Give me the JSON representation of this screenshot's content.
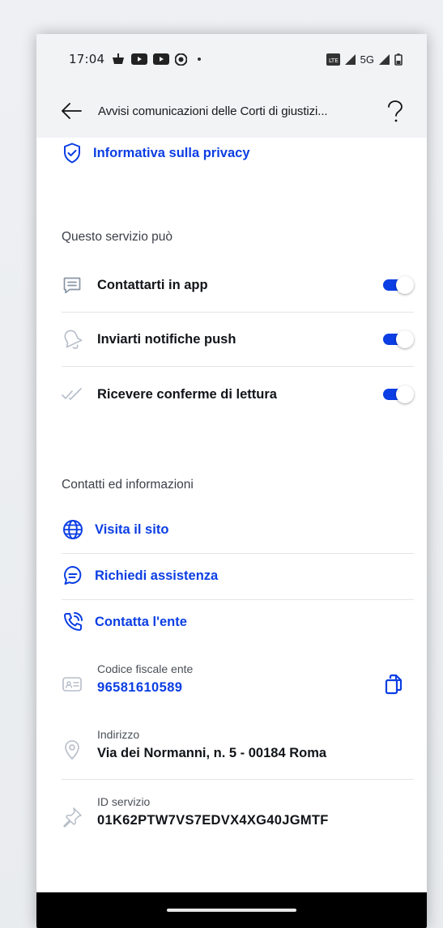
{
  "status_bar": {
    "time": "17:04",
    "network_label": "5G",
    "icons": [
      "app-notification-icon",
      "youtube-icon",
      "youtube-icon",
      "chrome-icon",
      "dot-icon",
      "volte-icon",
      "signal-icon",
      "signal-icon",
      "battery-icon"
    ]
  },
  "app_bar": {
    "title": "Avvisi comunicazioni delle Corti di giustizi...",
    "back_icon": "arrow-left-icon",
    "help_icon": "question-mark-icon"
  },
  "privacy": {
    "label": "Informativa sulla privacy",
    "icon": "shield-check-icon"
  },
  "service_section": {
    "title": "Questo servizio può",
    "items": [
      {
        "label": "Contattarti in app",
        "icon": "message-icon",
        "enabled": true
      },
      {
        "label": "Inviarti notifiche push",
        "icon": "bell-icon",
        "enabled": true
      },
      {
        "label": "Ricevere conferme di lettura",
        "icon": "double-check-icon",
        "enabled": true
      }
    ]
  },
  "contacts_section": {
    "title": "Contatti ed informazioni",
    "links": [
      {
        "label": "Visita il sito",
        "icon": "globe-icon"
      },
      {
        "label": "Richiedi assistenza",
        "icon": "chat-bubble-icon"
      },
      {
        "label": "Contatta l'ente",
        "icon": "phone-call-icon"
      }
    ],
    "fiscal_code": {
      "key": "Codice fiscale ente",
      "value": "96581610589",
      "icon": "id-card-icon",
      "copy_icon": "copy-icon"
    },
    "address": {
      "key": "Indirizzo",
      "value": "Via dei Normanni, n. 5 - 00184 Roma",
      "icon": "location-pin-icon"
    },
    "service_id": {
      "key": "ID servizio",
      "value": "01K62PTW7VS7EDVX4XG40JGMTF",
      "icon": "pushpin-icon"
    }
  },
  "colors": {
    "accent": "#0b3ee3",
    "text": "#111418",
    "muted": "#3b3f47",
    "bar_bg": "#f1f3f5"
  }
}
